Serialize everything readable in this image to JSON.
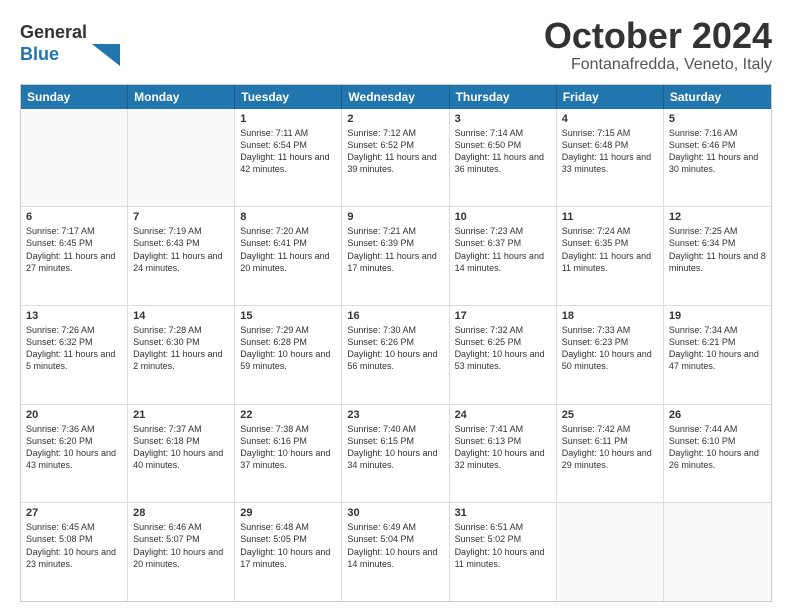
{
  "logo": {
    "line1": "General",
    "line2": "Blue"
  },
  "title": "October 2024",
  "subtitle": "Fontanafredda, Veneto, Italy",
  "days": [
    "Sunday",
    "Monday",
    "Tuesday",
    "Wednesday",
    "Thursday",
    "Friday",
    "Saturday"
  ],
  "weeks": [
    [
      {
        "day": "",
        "content": ""
      },
      {
        "day": "",
        "content": ""
      },
      {
        "day": "1",
        "content": "Sunrise: 7:11 AM\nSunset: 6:54 PM\nDaylight: 11 hours and 42 minutes."
      },
      {
        "day": "2",
        "content": "Sunrise: 7:12 AM\nSunset: 6:52 PM\nDaylight: 11 hours and 39 minutes."
      },
      {
        "day": "3",
        "content": "Sunrise: 7:14 AM\nSunset: 6:50 PM\nDaylight: 11 hours and 36 minutes."
      },
      {
        "day": "4",
        "content": "Sunrise: 7:15 AM\nSunset: 6:48 PM\nDaylight: 11 hours and 33 minutes."
      },
      {
        "day": "5",
        "content": "Sunrise: 7:16 AM\nSunset: 6:46 PM\nDaylight: 11 hours and 30 minutes."
      }
    ],
    [
      {
        "day": "6",
        "content": "Sunrise: 7:17 AM\nSunset: 6:45 PM\nDaylight: 11 hours and 27 minutes."
      },
      {
        "day": "7",
        "content": "Sunrise: 7:19 AM\nSunset: 6:43 PM\nDaylight: 11 hours and 24 minutes."
      },
      {
        "day": "8",
        "content": "Sunrise: 7:20 AM\nSunset: 6:41 PM\nDaylight: 11 hours and 20 minutes."
      },
      {
        "day": "9",
        "content": "Sunrise: 7:21 AM\nSunset: 6:39 PM\nDaylight: 11 hours and 17 minutes."
      },
      {
        "day": "10",
        "content": "Sunrise: 7:23 AM\nSunset: 6:37 PM\nDaylight: 11 hours and 14 minutes."
      },
      {
        "day": "11",
        "content": "Sunrise: 7:24 AM\nSunset: 6:35 PM\nDaylight: 11 hours and 11 minutes."
      },
      {
        "day": "12",
        "content": "Sunrise: 7:25 AM\nSunset: 6:34 PM\nDaylight: 11 hours and 8 minutes."
      }
    ],
    [
      {
        "day": "13",
        "content": "Sunrise: 7:26 AM\nSunset: 6:32 PM\nDaylight: 11 hours and 5 minutes."
      },
      {
        "day": "14",
        "content": "Sunrise: 7:28 AM\nSunset: 6:30 PM\nDaylight: 11 hours and 2 minutes."
      },
      {
        "day": "15",
        "content": "Sunrise: 7:29 AM\nSunset: 6:28 PM\nDaylight: 10 hours and 59 minutes."
      },
      {
        "day": "16",
        "content": "Sunrise: 7:30 AM\nSunset: 6:26 PM\nDaylight: 10 hours and 56 minutes."
      },
      {
        "day": "17",
        "content": "Sunrise: 7:32 AM\nSunset: 6:25 PM\nDaylight: 10 hours and 53 minutes."
      },
      {
        "day": "18",
        "content": "Sunrise: 7:33 AM\nSunset: 6:23 PM\nDaylight: 10 hours and 50 minutes."
      },
      {
        "day": "19",
        "content": "Sunrise: 7:34 AM\nSunset: 6:21 PM\nDaylight: 10 hours and 47 minutes."
      }
    ],
    [
      {
        "day": "20",
        "content": "Sunrise: 7:36 AM\nSunset: 6:20 PM\nDaylight: 10 hours and 43 minutes."
      },
      {
        "day": "21",
        "content": "Sunrise: 7:37 AM\nSunset: 6:18 PM\nDaylight: 10 hours and 40 minutes."
      },
      {
        "day": "22",
        "content": "Sunrise: 7:38 AM\nSunset: 6:16 PM\nDaylight: 10 hours and 37 minutes."
      },
      {
        "day": "23",
        "content": "Sunrise: 7:40 AM\nSunset: 6:15 PM\nDaylight: 10 hours and 34 minutes."
      },
      {
        "day": "24",
        "content": "Sunrise: 7:41 AM\nSunset: 6:13 PM\nDaylight: 10 hours and 32 minutes."
      },
      {
        "day": "25",
        "content": "Sunrise: 7:42 AM\nSunset: 6:11 PM\nDaylight: 10 hours and 29 minutes."
      },
      {
        "day": "26",
        "content": "Sunrise: 7:44 AM\nSunset: 6:10 PM\nDaylight: 10 hours and 26 minutes."
      }
    ],
    [
      {
        "day": "27",
        "content": "Sunrise: 6:45 AM\nSunset: 5:08 PM\nDaylight: 10 hours and 23 minutes."
      },
      {
        "day": "28",
        "content": "Sunrise: 6:46 AM\nSunset: 5:07 PM\nDaylight: 10 hours and 20 minutes."
      },
      {
        "day": "29",
        "content": "Sunrise: 6:48 AM\nSunset: 5:05 PM\nDaylight: 10 hours and 17 minutes."
      },
      {
        "day": "30",
        "content": "Sunrise: 6:49 AM\nSunset: 5:04 PM\nDaylight: 10 hours and 14 minutes."
      },
      {
        "day": "31",
        "content": "Sunrise: 6:51 AM\nSunset: 5:02 PM\nDaylight: 10 hours and 11 minutes."
      },
      {
        "day": "",
        "content": ""
      },
      {
        "day": "",
        "content": ""
      }
    ]
  ]
}
